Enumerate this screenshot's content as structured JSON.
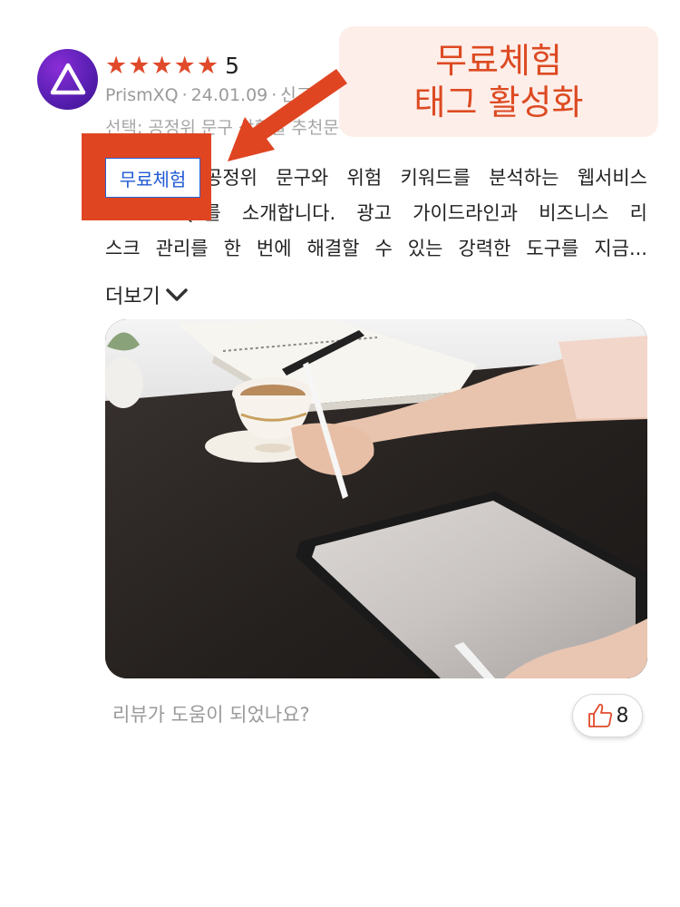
{
  "review": {
    "rating_value": "5",
    "star_count": 5,
    "reviewer": "PrismXQ",
    "date": "24.01.09",
    "report_label": "신고",
    "selection": "선택: 공정위 문구 상황별 추천문구",
    "tag": "무료체험",
    "body_lines": [
      "공정위 문구와 위험 키워드를 분석하는 웹서비스",
      "\"PrismXQ\"를 소개합니다. 광고 가이드라인과 비즈니스 리",
      "스크 관리를 한 번에 해결할 수 있는 강력한 도구를 지금..."
    ],
    "more_label": "더보기",
    "helpful_question": "리뷰가 도움이 되었나요?",
    "like_count": "8"
  },
  "annotation": {
    "line1": "무료체험",
    "line2": "태그 활성화",
    "color": "#dd4a22",
    "bg": "#fdeee9"
  },
  "colors": {
    "star": "#e04a2a",
    "highlight": "#e04522",
    "tag_text": "#1f5ad4"
  }
}
